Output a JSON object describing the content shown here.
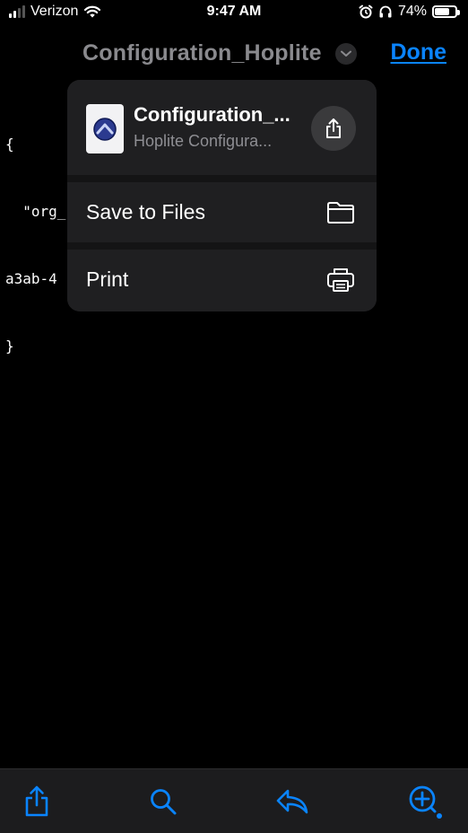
{
  "status_bar": {
    "carrier": "Verizon",
    "time": "9:47 AM",
    "battery_percent": "74%",
    "battery_level": 0.74,
    "icons": [
      "signal-icon",
      "wifi-icon",
      "alarm-icon",
      "headphones-icon",
      "battery-icon"
    ]
  },
  "nav": {
    "title": "Configuration_Hoplite",
    "done_label": "Done"
  },
  "document": {
    "lines": [
      "{",
      "  \"org_",
      "a3ab-4",
      "}"
    ]
  },
  "share_sheet": {
    "file_title": "Configuration_...",
    "file_subtitle": "Hoplite Configura...",
    "actions": [
      {
        "label": "Save to Files",
        "icon": "folder-icon"
      },
      {
        "label": "Print",
        "icon": "printer-icon"
      }
    ]
  },
  "toolbar": {
    "icons": [
      "share-icon",
      "search-icon",
      "reply-icon",
      "markup-icon"
    ]
  },
  "colors": {
    "accent": "#0a84ff",
    "background": "#000000",
    "sheet": "#1f1f21",
    "secondary_text": "#8e8e93"
  }
}
